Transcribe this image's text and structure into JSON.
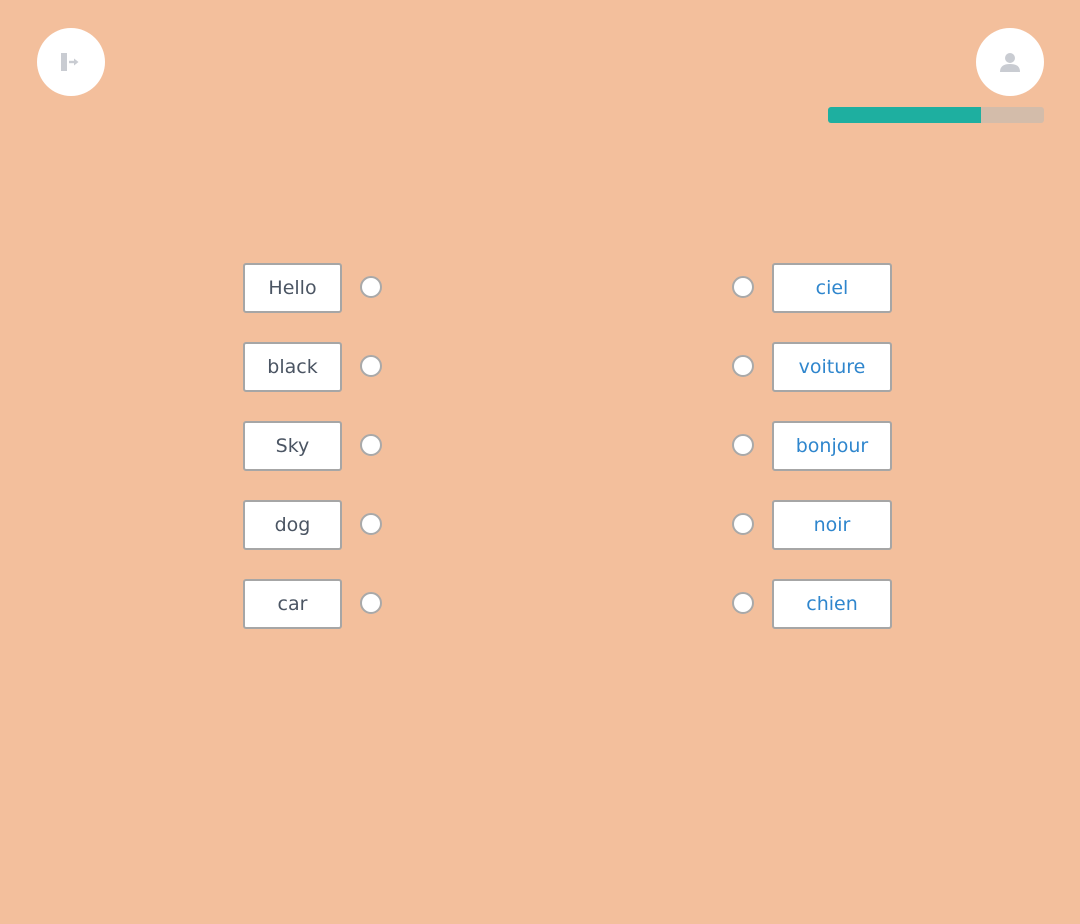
{
  "header": {
    "exit_icon": "exit-icon",
    "profile_icon": "person-icon",
    "progress_fraction": 0.71,
    "progress_color": "#1eafa0",
    "progress_track_color": "#d3bcaa"
  },
  "colors": {
    "background": "#f3bf9c",
    "left_text": "#4b5563",
    "right_text": "#2f86cd"
  },
  "left_words": [
    "Hello",
    "black",
    "Sky",
    "dog",
    "car"
  ],
  "right_words": [
    "ciel",
    "voiture",
    "bonjour",
    "noir",
    "chien"
  ]
}
